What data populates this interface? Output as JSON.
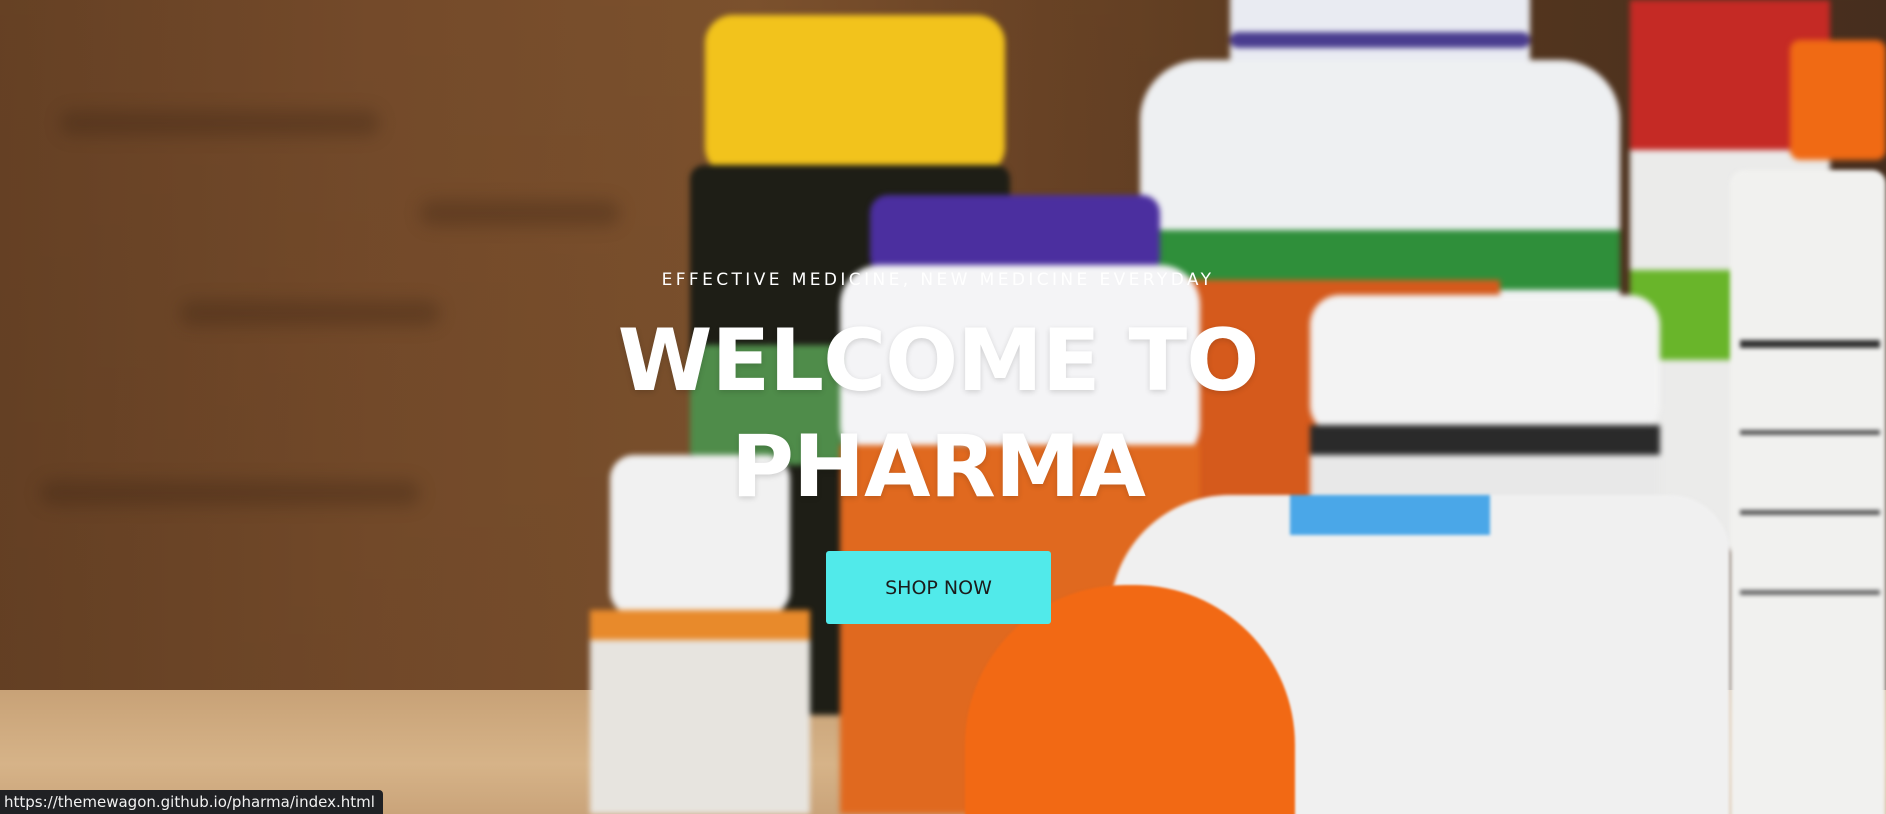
{
  "hero": {
    "tagline": "EFFECTIVE MEDICINE, NEW MEDICINE EVERYDAY",
    "headline_line1": "WELCOME TO",
    "headline_line2": "PHARMA",
    "cta_label": "SHOP NOW"
  },
  "status_bar": {
    "url": "https://themewagon.github.io/pharma/index.html"
  },
  "colors": {
    "cta_background": "#51eaea",
    "headline": "#ffffff",
    "status_bar": "#202124"
  }
}
